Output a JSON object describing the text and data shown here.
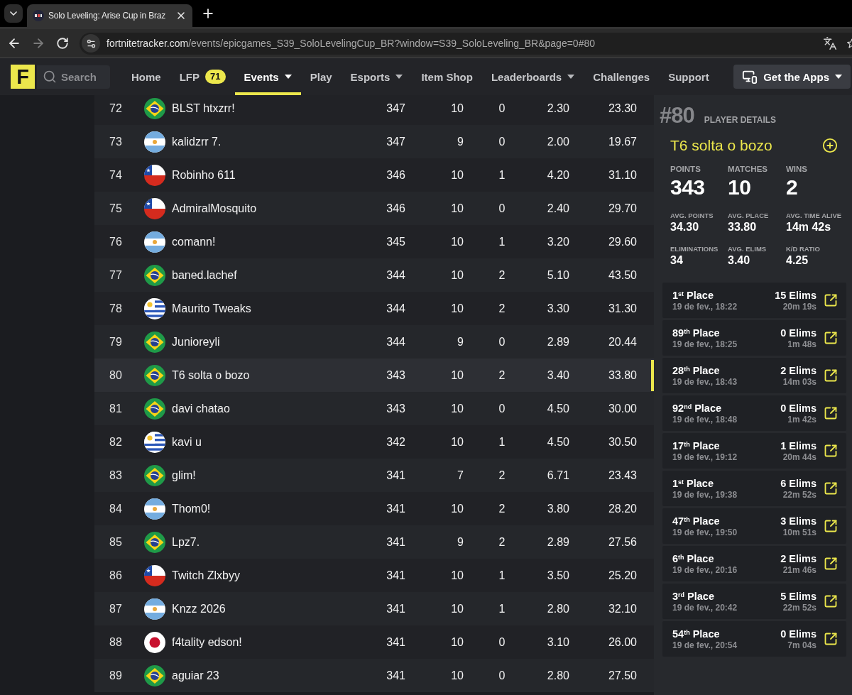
{
  "browser": {
    "tab": {
      "title": "Solo Leveling: Arise Cup in Braz"
    },
    "address": {
      "host": "fortnitetracker.com",
      "path": "/events/epicgames_S39_SoloLevelingCup_BR?window=S39_SoloLeveling_BR&page=0#80"
    }
  },
  "site_nav": {
    "logo": "F",
    "search": {
      "placeholder": "Search"
    },
    "items": [
      {
        "label": "Home",
        "selected": false,
        "dropdown": false
      },
      {
        "label": "LFP",
        "selected": false,
        "dropdown": false,
        "badge": "71"
      },
      {
        "label": "Events",
        "selected": true,
        "dropdown": true
      },
      {
        "label": "Play",
        "selected": false,
        "dropdown": false
      },
      {
        "label": "Esports",
        "selected": false,
        "dropdown": true
      },
      {
        "label": "Item Shop",
        "selected": false,
        "dropdown": false
      },
      {
        "label": "Leaderboards",
        "selected": false,
        "dropdown": true
      },
      {
        "label": "Challenges",
        "selected": false,
        "dropdown": false
      },
      {
        "label": "Support",
        "selected": false,
        "dropdown": false
      }
    ],
    "apps_button": {
      "label": "Get the Apps",
      "dropdown": true
    }
  },
  "leaderboard": {
    "rows": [
      {
        "rank": "72",
        "kind": "brazil",
        "name": "BLST htxzrr!",
        "cells": [
          "347",
          "10",
          "0",
          "2.30",
          "23.30"
        ],
        "selected": false
      },
      {
        "rank": "73",
        "kind": "argentina",
        "name": "kalidzrr 7.",
        "cells": [
          "347",
          "9",
          "0",
          "2.00",
          "19.67"
        ],
        "selected": false
      },
      {
        "rank": "74",
        "kind": "chile",
        "name": "Robinho 611",
        "cells": [
          "346",
          "10",
          "1",
          "4.20",
          "31.10"
        ],
        "selected": false
      },
      {
        "rank": "75",
        "kind": "chile",
        "name": "AdmiralMosquito",
        "cells": [
          "346",
          "10",
          "0",
          "2.40",
          "29.70"
        ],
        "selected": false
      },
      {
        "rank": "76",
        "kind": "argentina",
        "name": "comann!",
        "cells": [
          "345",
          "10",
          "1",
          "3.20",
          "29.60"
        ],
        "selected": false
      },
      {
        "rank": "77",
        "kind": "brazil",
        "name": "baned.lachef",
        "cells": [
          "344",
          "10",
          "2",
          "5.10",
          "43.50"
        ],
        "selected": false
      },
      {
        "rank": "78",
        "kind": "uruguay",
        "name": "Maurito Tweaks",
        "cells": [
          "344",
          "10",
          "2",
          "3.30",
          "31.30"
        ],
        "selected": false
      },
      {
        "rank": "79",
        "kind": "brazil",
        "name": "Junioreyli",
        "cells": [
          "344",
          "9",
          "0",
          "2.89",
          "20.44"
        ],
        "selected": false
      },
      {
        "rank": "80",
        "kind": "brazil",
        "name": "T6 solta o bozo",
        "cells": [
          "343",
          "10",
          "2",
          "3.40",
          "33.80"
        ],
        "selected": true
      },
      {
        "rank": "81",
        "kind": "brazil",
        "name": "davi chatao",
        "cells": [
          "343",
          "10",
          "0",
          "4.50",
          "30.00"
        ],
        "selected": false
      },
      {
        "rank": "82",
        "kind": "uruguay",
        "name": "kavi u",
        "cells": [
          "342",
          "10",
          "1",
          "4.50",
          "30.50"
        ],
        "selected": false
      },
      {
        "rank": "83",
        "kind": "brazil",
        "name": "glim!",
        "cells": [
          "341",
          "7",
          "2",
          "6.71",
          "23.43"
        ],
        "selected": false
      },
      {
        "rank": "84",
        "kind": "argentina",
        "name": "Thom0!",
        "cells": [
          "341",
          "10",
          "2",
          "3.80",
          "28.20"
        ],
        "selected": false
      },
      {
        "rank": "85",
        "kind": "brazil",
        "name": "Lpz7.",
        "cells": [
          "341",
          "9",
          "2",
          "2.89",
          "27.56"
        ],
        "selected": false
      },
      {
        "rank": "86",
        "kind": "chile",
        "name": "Twitch Zlxbyy",
        "cells": [
          "341",
          "10",
          "1",
          "3.50",
          "25.20"
        ],
        "selected": false
      },
      {
        "rank": "87",
        "kind": "argentina",
        "name": "Knzz 2026",
        "cells": [
          "341",
          "10",
          "1",
          "2.80",
          "32.10"
        ],
        "selected": false
      },
      {
        "rank": "88",
        "kind": "japan",
        "name": "f4tality edson!",
        "cells": [
          "341",
          "10",
          "0",
          "3.10",
          "26.00"
        ],
        "selected": false
      },
      {
        "rank": "89",
        "kind": "brazil",
        "name": "aguiar 23",
        "cells": [
          "341",
          "10",
          "0",
          "2.80",
          "27.50"
        ],
        "selected": false
      }
    ]
  },
  "player_details": {
    "rank": "#80",
    "heading": "PLAYER DETAILS",
    "name": "T6 solta o bozo",
    "primary_stats": [
      {
        "label": "POINTS",
        "value": "343"
      },
      {
        "label": "MATCHES",
        "value": "10"
      },
      {
        "label": "WINS",
        "value": "2"
      }
    ],
    "secondary_stats": [
      {
        "label": "AVG. POINTS",
        "value": "34.30"
      },
      {
        "label": "AVG. PLACE",
        "value": "33.80"
      },
      {
        "label": "AVG. TIME ALIVE",
        "value": "14m 42s"
      },
      {
        "label": "ELIMINATIONS",
        "value": "34"
      },
      {
        "label": "AVG. ELIMS",
        "value": "3.40"
      },
      {
        "label": "K/D RATIO",
        "value": "4.25"
      }
    ],
    "matches": [
      {
        "place": "1$^{st}$ Place",
        "date": "19 de fev., 18:22",
        "elims": "15 Elims",
        "time": "20m 19s"
      },
      {
        "place": "89$^{th}$ Place",
        "date": "19 de fev., 18:25",
        "elims": "0 Elims",
        "time": "1m 48s"
      },
      {
        "place": "28$^{th}$ Place",
        "date": "19 de fev., 18:43",
        "elims": "2 Elims",
        "time": "14m 03s"
      },
      {
        "place": "92$^{nd}$ Place",
        "date": "19 de fev., 18:48",
        "elims": "0 Elims",
        "time": "1m 42s"
      },
      {
        "place": "17$^{th}$ Place",
        "date": "19 de fev., 19:12",
        "elims": "1 Elims",
        "time": "20m 44s"
      },
      {
        "place": "1$^{st}$ Place",
        "date": "19 de fev., 19:38",
        "elims": "6 Elims",
        "time": "22m 52s"
      },
      {
        "place": "47$^{th}$ Place",
        "date": "19 de fev., 19:50",
        "elims": "3 Elims",
        "time": "10m 51s"
      },
      {
        "place": "6$^{th}$ Place",
        "date": "19 de fev., 20:16",
        "elims": "2 Elims",
        "time": "21m 46s"
      },
      {
        "place": "3$^{rd}$ Place",
        "date": "19 de fev., 20:42",
        "elims": "5 Elims",
        "time": "22m 52s"
      },
      {
        "place": "54$^{th}$ Place",
        "date": "19 de fev., 20:54",
        "elims": "0 Elims",
        "time": "7m 04s"
      }
    ]
  }
}
